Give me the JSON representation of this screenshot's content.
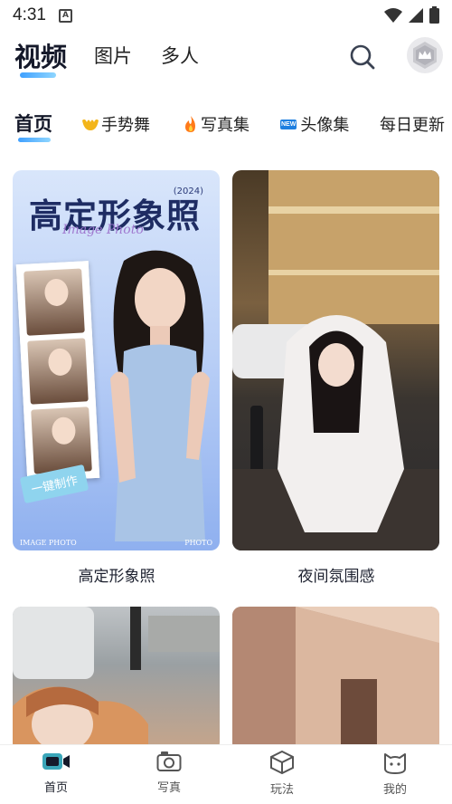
{
  "status": {
    "time": "4:31",
    "notif_letter": "A"
  },
  "top_tabs": [
    {
      "label": "视频",
      "active": true
    },
    {
      "label": "图片",
      "active": false
    },
    {
      "label": "多人",
      "active": false
    }
  ],
  "categories": [
    {
      "label": "首页",
      "active": true,
      "icon": ""
    },
    {
      "label": "手势舞",
      "icon": "hand-icon"
    },
    {
      "label": "写真集",
      "icon": "fire-icon"
    },
    {
      "label": "头像集",
      "icon": "new-badge-icon",
      "badge": "NEW"
    },
    {
      "label": "每日更新",
      "icon": ""
    }
  ],
  "cards": [
    {
      "title": "高定形象照",
      "poster_title": "高定形象照",
      "poster_year": "(2024)",
      "poster_sub": "Image Photo",
      "poster_button": "一键制作",
      "poster_foot_left": "IMAGE PHOTO",
      "poster_foot_right": "PHOTO"
    },
    {
      "title": "夜间氛围感"
    },
    {
      "title": ""
    },
    {
      "title": ""
    }
  ],
  "bottom_nav": [
    {
      "label": "首页",
      "icon": "camera-video-icon",
      "active": true
    },
    {
      "label": "写真",
      "icon": "photo-camera-icon",
      "active": false
    },
    {
      "label": "玩法",
      "icon": "cube-icon",
      "active": false
    },
    {
      "label": "我的",
      "icon": "cat-face-icon",
      "active": false
    }
  ],
  "colors": {
    "accent_blue": "#3fa0ff",
    "nav_active": "#1b1f2a",
    "nav_icon_teal": "#3aa6b9"
  }
}
